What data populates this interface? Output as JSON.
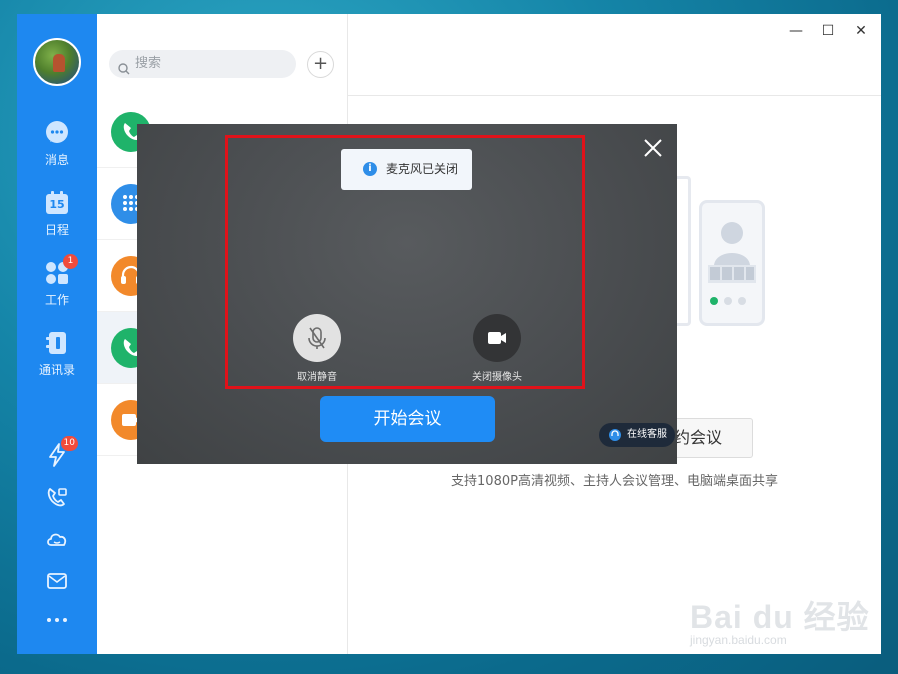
{
  "nav": {
    "items": [
      {
        "label": "消息",
        "icon": "chat-bubble-icon"
      },
      {
        "label": "日程",
        "icon": "calendar-icon",
        "date": "15"
      },
      {
        "label": "工作",
        "icon": "apps-icon",
        "badge": "1"
      },
      {
        "label": "通讯录",
        "icon": "contacts-icon"
      }
    ],
    "bottom": [
      {
        "icon": "flash-icon",
        "badge": "10"
      },
      {
        "icon": "video-call-icon"
      },
      {
        "icon": "cloud-icon"
      },
      {
        "icon": "mail-icon"
      },
      {
        "icon": "more-icon"
      }
    ]
  },
  "search": {
    "placeholder": "搜索"
  },
  "add_label": "+",
  "list": [
    {
      "icon": "phone-icon",
      "color": "#1fb36a"
    },
    {
      "icon": "dialpad-icon",
      "color": "#2f8ee8"
    },
    {
      "icon": "headset-icon",
      "color": "#f2892b"
    },
    {
      "icon": "phone-icon",
      "color": "#1fb36a"
    },
    {
      "icon": "video-icon",
      "color": "#f2892b"
    }
  ],
  "window_controls": {
    "minimize": "—",
    "maximize": "☐",
    "close": "✕"
  },
  "right": {
    "reserve_label": "约会议",
    "description": "支持1080P高清视频、主持人会议管理、电脑端桌面共享"
  },
  "modal": {
    "toast": "麦克风已关闭",
    "toast_icon": "i",
    "mute_label": "取消静音",
    "camera_label": "关闭摄像头",
    "start_label": "开始会议"
  },
  "cs_label": "在线客服",
  "watermark": {
    "main": "Bai du 经验",
    "sub": "jingyan.baidu.com"
  },
  "colors": {
    "nav": "#1e88f0",
    "primary": "#1f8cf5",
    "highlight": "#e0121a"
  }
}
